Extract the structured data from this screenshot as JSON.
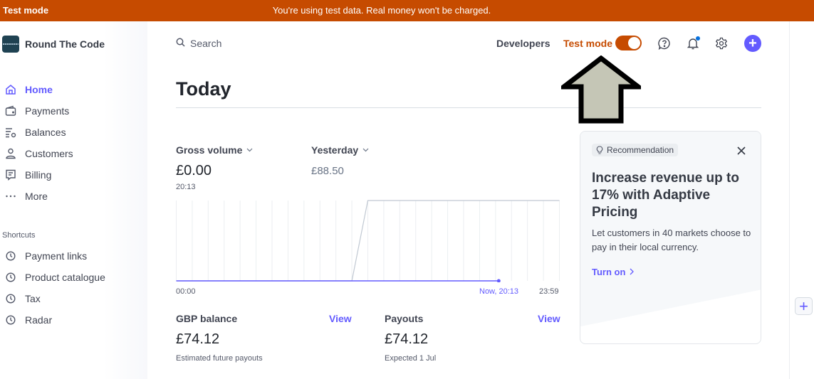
{
  "banner": {
    "label": "Test mode",
    "message": "You're using test data. Real money won't be charged.",
    "color": "#c64b00"
  },
  "account": {
    "name": "Round The Code"
  },
  "nav": {
    "items": [
      {
        "label": "Home",
        "icon": "home-icon",
        "active": true
      },
      {
        "label": "Payments",
        "icon": "wallet-icon",
        "active": false
      },
      {
        "label": "Balances",
        "icon": "balances-icon",
        "active": false
      },
      {
        "label": "Customers",
        "icon": "person-icon",
        "active": false
      },
      {
        "label": "Billing",
        "icon": "receipt-icon",
        "active": false
      },
      {
        "label": "More",
        "icon": "more-dots-icon",
        "active": false
      }
    ],
    "shortcuts_label": "Shortcuts",
    "shortcuts": [
      {
        "label": "Payment links",
        "icon": "clock-icon"
      },
      {
        "label": "Product catalogue",
        "icon": "clock-icon"
      },
      {
        "label": "Tax",
        "icon": "clock-icon"
      },
      {
        "label": "Radar",
        "icon": "clock-icon"
      }
    ]
  },
  "topbar": {
    "search_placeholder": "Search",
    "developers": "Developers",
    "test_mode_label": "Test mode",
    "test_mode_on": true,
    "icons": [
      "help-icon",
      "bell-icon",
      "gear-icon",
      "plus-icon"
    ],
    "accent": "#635bff"
  },
  "page": {
    "title": "Today"
  },
  "metrics": {
    "gross_volume": {
      "label": "Gross volume",
      "value": "£0.00",
      "time": "20:13"
    },
    "comparison": {
      "label": "Yesterday",
      "value": "£88.50"
    }
  },
  "chart_data": {
    "type": "line",
    "x_start_label": "00:00",
    "x_now_label": "Now, 20:13",
    "x_end_label": "23:59",
    "x_range_hours": [
      0,
      24
    ],
    "grid": "vertical hourly",
    "series": [
      {
        "name": "Today",
        "color": "#635bff",
        "points": [
          [
            0,
            0
          ],
          [
            20.2,
            0
          ]
        ]
      },
      {
        "name": "Yesterday",
        "color": "#c0c8d2",
        "points": [
          [
            0,
            0
          ],
          [
            11,
            0
          ],
          [
            12,
            88.5
          ],
          [
            24,
            88.5
          ]
        ]
      }
    ],
    "ylim": [
      0,
      88.5
    ]
  },
  "balances": {
    "gbp": {
      "title": "GBP balance",
      "view": "View",
      "value": "£74.12",
      "sub": "Estimated future payouts"
    },
    "payouts": {
      "title": "Payouts",
      "view": "View",
      "value": "£74.12",
      "sub": "Expected 1 Jul"
    }
  },
  "recommendation": {
    "badge": "Recommendation",
    "title": "Increase revenue up to 17% with Adaptive Pricing",
    "body": "Let customers in 40 markets choose to pay in their local currency.",
    "cta": "Turn on"
  }
}
